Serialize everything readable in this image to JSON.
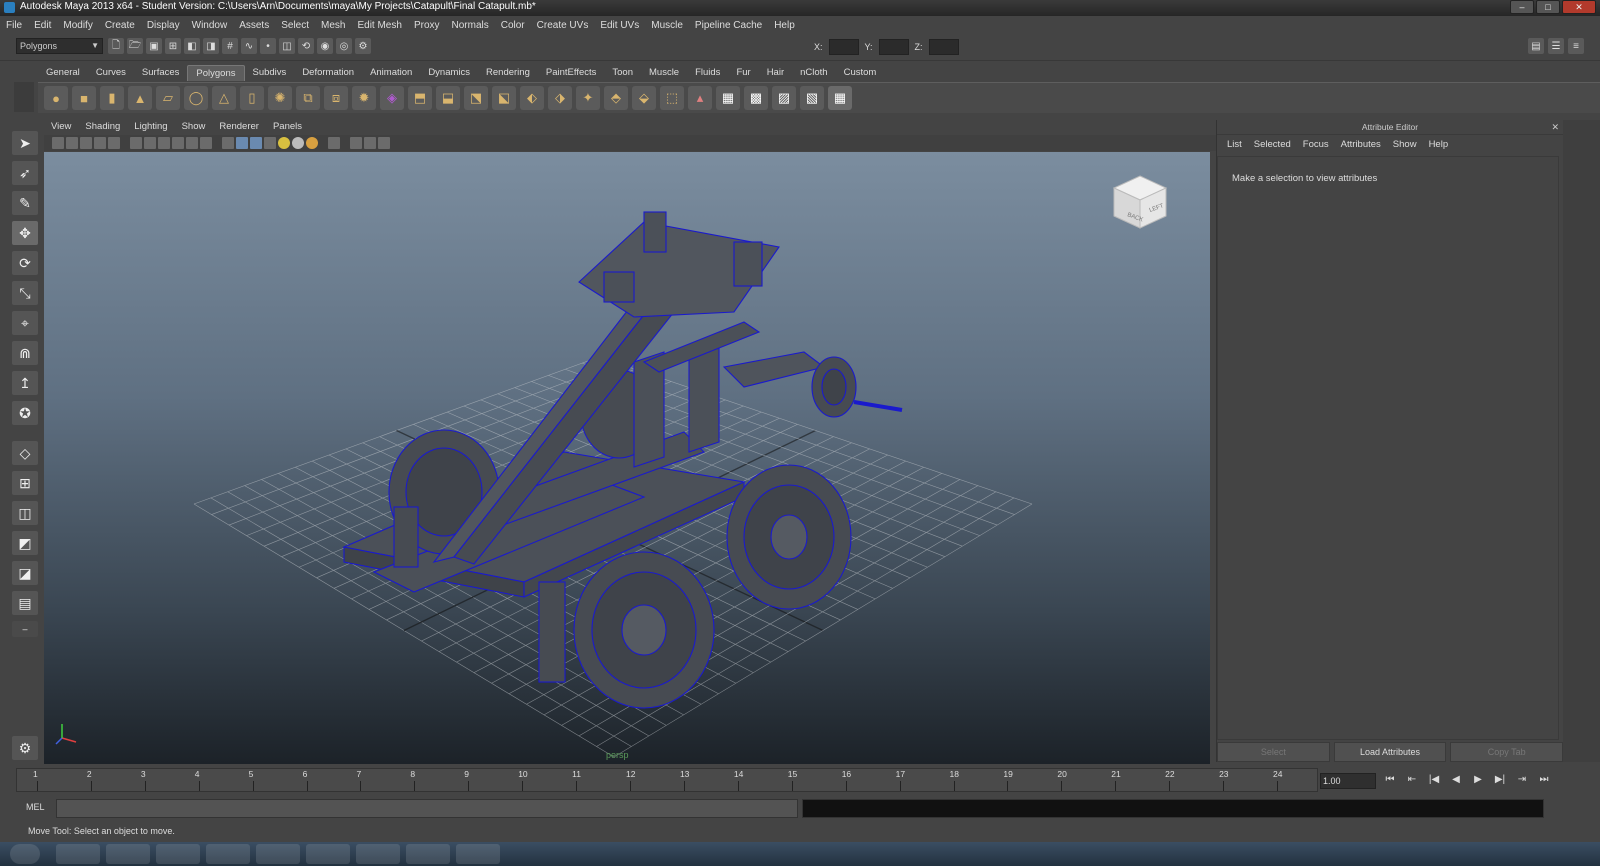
{
  "window": {
    "title": "Autodesk Maya 2013 x64 - Student Version: C:\\Users\\Arn\\Documents\\maya\\My Projects\\Catapult\\Final Catapult.mb*"
  },
  "menubar": [
    "File",
    "Edit",
    "Modify",
    "Create",
    "Display",
    "Window",
    "Assets",
    "Select",
    "Mesh",
    "Edit Mesh",
    "Proxy",
    "Normals",
    "Color",
    "Create UVs",
    "Edit UVs",
    "Muscle",
    "Pipeline Cache",
    "Help"
  ],
  "statusline": {
    "mode": "Polygons",
    "x_label": "X:",
    "y_label": "Y:",
    "z_label": "Z:"
  },
  "shelf_tabs": {
    "tabs": [
      "General",
      "Curves",
      "Surfaces",
      "Polygons",
      "Subdivs",
      "Deformation",
      "Animation",
      "Dynamics",
      "Rendering",
      "PaintEffects",
      "Toon",
      "Muscle",
      "Fluids",
      "Fur",
      "Hair",
      "nCloth",
      "Custom"
    ],
    "active": "Polygons"
  },
  "viewport": {
    "menu": [
      "View",
      "Shading",
      "Lighting",
      "Show",
      "Renderer",
      "Panels"
    ],
    "viewcube": {
      "face1": "BACK",
      "face2": "LEFT"
    },
    "camera_label": "persp"
  },
  "attribute_editor": {
    "title": "Attribute Editor",
    "menu": [
      "List",
      "Selected",
      "Focus",
      "Attributes",
      "Show",
      "Help"
    ],
    "message": "Make a selection to view attributes",
    "buttons": {
      "select": "Select",
      "load": "Load Attributes",
      "copy": "Copy Tab"
    }
  },
  "timeline": {
    "frames": [
      "1",
      "2",
      "3",
      "4",
      "5",
      "6",
      "7",
      "8",
      "9",
      "10",
      "11",
      "12",
      "13",
      "14",
      "15",
      "16",
      "17",
      "18",
      "19",
      "20",
      "21",
      "22",
      "23",
      "24"
    ],
    "current_frame": "1.00"
  },
  "command_line": {
    "label": "MEL"
  },
  "help_line": {
    "text": "Move Tool: Select an object to move."
  },
  "colors": {
    "wireframe": "#1a1acc",
    "viewport_top": "#7b8d9f",
    "viewport_bottom": "#1c2228",
    "grid": "#c8ccd0"
  }
}
